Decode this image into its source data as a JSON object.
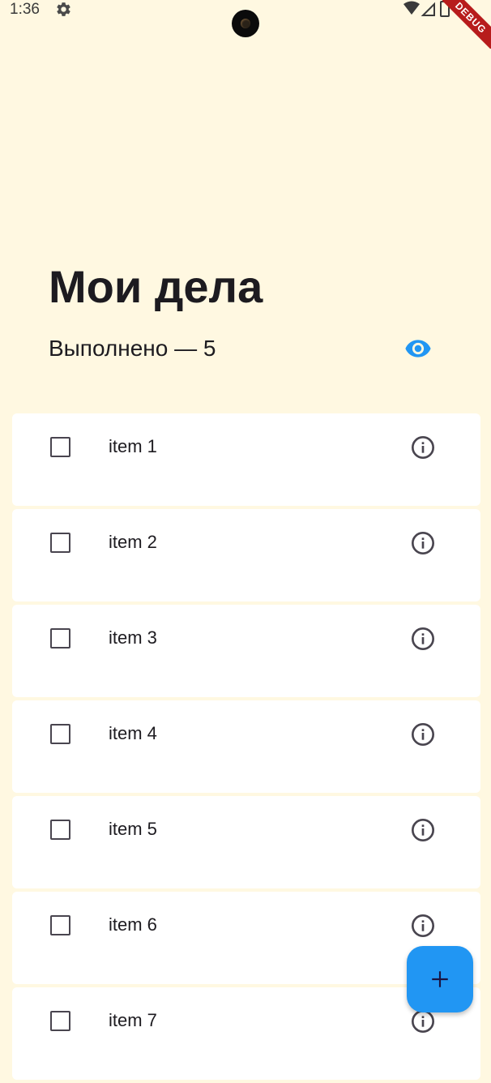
{
  "status_bar": {
    "time": "1:36",
    "icons": [
      "gear-icon",
      "wifi-icon",
      "signal-icon",
      "battery-icon"
    ]
  },
  "debug_banner": {
    "label": "DEBUG"
  },
  "header": {
    "title": "Мои дела",
    "done_label": "Выполнено — 5",
    "visibility_icon": "eye-icon"
  },
  "tasks": [
    {
      "label": "item 1",
      "checked": false
    },
    {
      "label": "item 2",
      "checked": false
    },
    {
      "label": "item 3",
      "checked": false
    },
    {
      "label": "item 4",
      "checked": false
    },
    {
      "label": "item 5",
      "checked": false
    },
    {
      "label": "item 6",
      "checked": false
    },
    {
      "label": "item 7",
      "checked": false
    }
  ],
  "fab": {
    "icon": "add-icon"
  },
  "colors": {
    "background": "#FFF8E1",
    "card": "#FFFFFF",
    "accent": "#2196F3",
    "text": "#1D1B20",
    "icon": "#49454F",
    "debug": "#B71C1C"
  }
}
